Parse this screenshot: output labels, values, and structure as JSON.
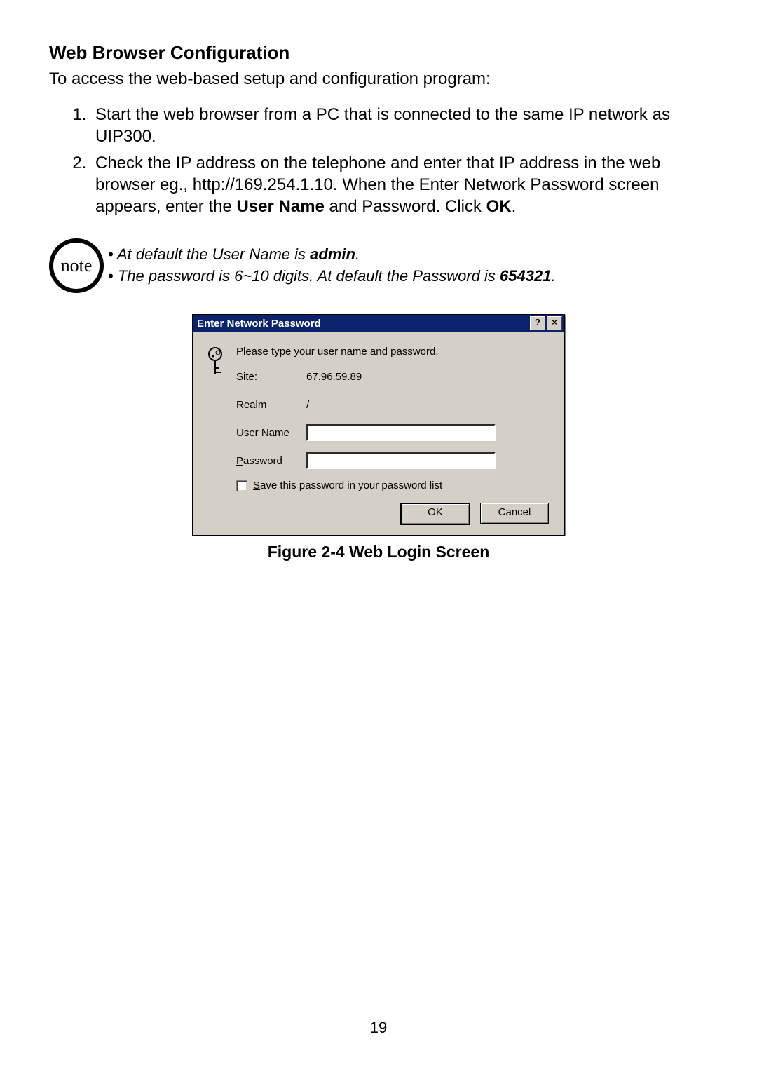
{
  "section": {
    "title": "Web Browser Configuration",
    "intro": "To access the web-based setup and configuration program:"
  },
  "steps": {
    "item1": "Start the web browser from a PC that is connected to the same IP network as UIP300.",
    "item2_pre": "Check the IP address on the telephone and enter that IP address in the web browser eg., http://169.254.1.10. When the Enter Network Password screen appears, enter the ",
    "item2_bold1": "User Name",
    "item2_mid": " and Password. Click ",
    "item2_bold2": "OK",
    "item2_post": "."
  },
  "note": {
    "badge": "note",
    "line1_pre": "At default the User Name is ",
    "line1_bold": "admin",
    "line1_post": ".",
    "line2_pre": "The password is 6~10 digits. At default the Password is ",
    "line2_bold": "654321",
    "line2_post": "."
  },
  "dialog": {
    "title": "Enter Network Password",
    "help_glyph": "?",
    "close_glyph": "×",
    "prompt": "Please type your user name and password.",
    "site_label": "Site:",
    "site_value": "67.96.59.89",
    "realm_label_letter": "R",
    "realm_label_rest": "ealm",
    "realm_value": "/",
    "user_label_letter": "U",
    "user_label_rest": "ser Name",
    "user_value": "",
    "pass_label_letter": "P",
    "pass_label_rest": "assword",
    "pass_value": "",
    "save_cb_letter": "S",
    "save_cb_rest": "ave this password in your password list",
    "ok_btn": "OK",
    "cancel_btn": "Cancel"
  },
  "figure_caption": "Figure 2-4 Web Login Screen",
  "page_number": "19"
}
